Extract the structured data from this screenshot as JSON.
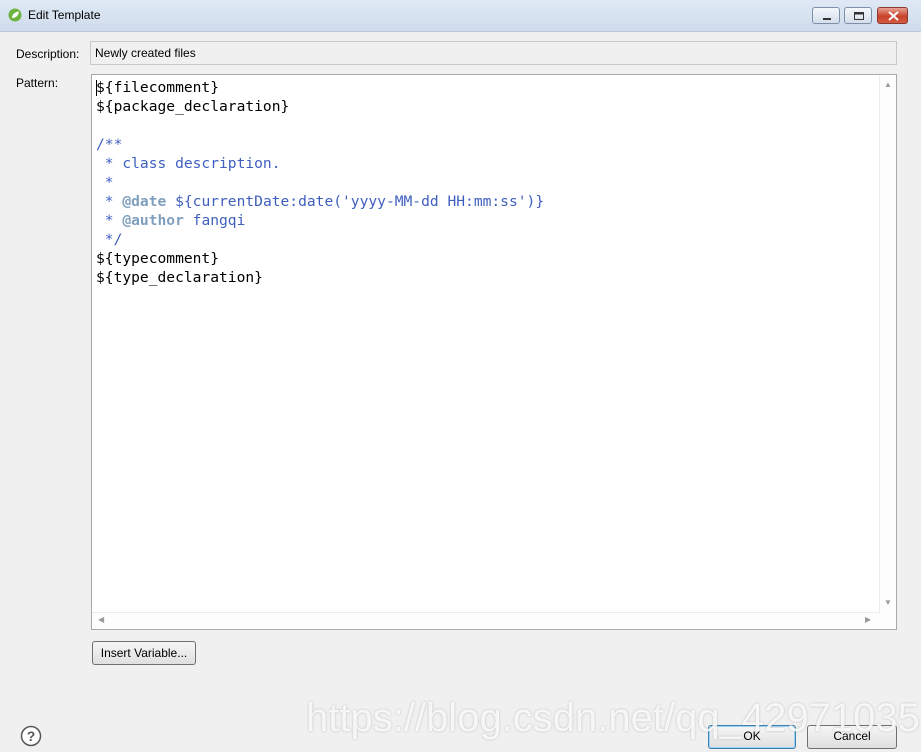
{
  "window": {
    "title": "Edit Template"
  },
  "form": {
    "description_label": "Description:",
    "description_value": "Newly created files",
    "pattern_label": "Pattern:"
  },
  "pattern_lines": [
    {
      "text": "${filecomment}",
      "style": "normal"
    },
    {
      "text": "${package_declaration}",
      "style": "normal"
    },
    {
      "text": "",
      "style": "normal"
    },
    {
      "text": "/**",
      "style": "comment"
    },
    {
      "text": " * class description.",
      "style": "comment"
    },
    {
      "text": " *",
      "style": "comment"
    },
    {
      "text": " * @date ${currentDate:date('yyyy-MM-dd HH:mm:ss')}",
      "style": "comment-tag",
      "tag": "@date"
    },
    {
      "text": " * @author fangqi",
      "style": "comment-tag",
      "tag": "@author"
    },
    {
      "text": " */",
      "style": "comment"
    },
    {
      "text": "${typecomment}",
      "style": "normal"
    },
    {
      "text": "${type_declaration}",
      "style": "normal"
    }
  ],
  "buttons": {
    "insert_variable": "Insert Variable...",
    "ok": "OK",
    "cancel": "Cancel"
  },
  "watermark": "https://blog.csdn.net/qq_42971035",
  "colors": {
    "comment": "#3f5fbf",
    "javadoc_tag": "#7f9fbf",
    "titlebar": "#dbe6f3"
  },
  "icons": {
    "app": "spring-leaf-icon",
    "help": "help-icon"
  }
}
